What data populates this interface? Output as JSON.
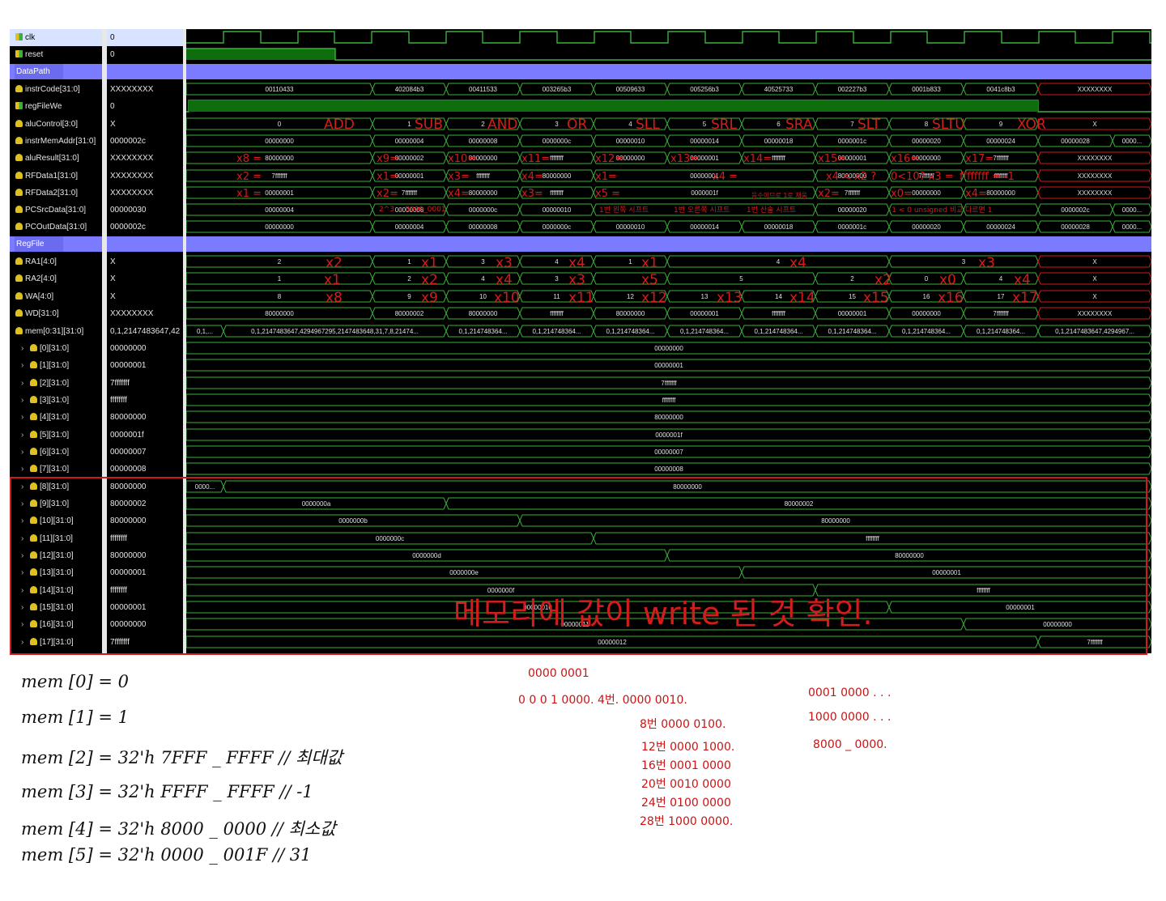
{
  "colors": {
    "accent": "#7b7bff",
    "wave": "#3ab03a",
    "background": "#000000",
    "ink": "#d41c1c",
    "undefined": "#d21919"
  },
  "signals": [
    {
      "icon": "bit-icon",
      "name": "clk",
      "value": "0",
      "selected": true
    },
    {
      "icon": "bit-icon",
      "name": "reset",
      "value": "0"
    },
    {
      "group": true,
      "name": "DataPath"
    },
    {
      "icon": "bus-icon",
      "name": "instrCode[31:0]",
      "value": "XXXXXXXX"
    },
    {
      "icon": "bit-icon",
      "name": "regFileWe",
      "value": "0"
    },
    {
      "icon": "bus-icon",
      "name": "aluControl[3:0]",
      "value": "X"
    },
    {
      "icon": "bus-icon",
      "name": "instrMemAddr[31:0]",
      "value": "0000002c"
    },
    {
      "icon": "bus-icon",
      "name": "aluResult[31:0]",
      "value": "XXXXXXXX"
    },
    {
      "icon": "bus-icon",
      "name": "RFData1[31:0]",
      "value": "XXXXXXXX"
    },
    {
      "icon": "bus-icon",
      "name": "RFData2[31:0]",
      "value": "XXXXXXXX"
    },
    {
      "icon": "bus-icon",
      "name": "PCSrcData[31:0]",
      "value": "00000030"
    },
    {
      "icon": "bus-icon",
      "name": "PCOutData[31:0]",
      "value": "0000002c"
    },
    {
      "group": true,
      "name": "RegFile"
    },
    {
      "icon": "bus-icon",
      "name": "RA1[4:0]",
      "value": "X"
    },
    {
      "icon": "bus-icon",
      "name": "RA2[4:0]",
      "value": "X"
    },
    {
      "icon": "bus-icon",
      "name": "WA[4:0]",
      "value": "X"
    },
    {
      "icon": "bus-icon",
      "name": "WD[31:0]",
      "value": "XXXXXXXX"
    },
    {
      "icon": "bus-icon",
      "name": "mem[0:31][31:0]",
      "value": "0,1,2147483647,42"
    },
    {
      "icon": "bus-icon",
      "name": "[0][31:0]",
      "value": "00000000",
      "child": true
    },
    {
      "icon": "bus-icon",
      "name": "[1][31:0]",
      "value": "00000001",
      "child": true
    },
    {
      "icon": "bus-icon",
      "name": "[2][31:0]",
      "value": "7fffffff",
      "child": true
    },
    {
      "icon": "bus-icon",
      "name": "[3][31:0]",
      "value": "ffffffff",
      "child": true
    },
    {
      "icon": "bus-icon",
      "name": "[4][31:0]",
      "value": "80000000",
      "child": true
    },
    {
      "icon": "bus-icon",
      "name": "[5][31:0]",
      "value": "0000001f",
      "child": true
    },
    {
      "icon": "bus-icon",
      "name": "[6][31:0]",
      "value": "00000007",
      "child": true
    },
    {
      "icon": "bus-icon",
      "name": "[7][31:0]",
      "value": "00000008",
      "child": true
    },
    {
      "icon": "bus-icon",
      "name": "[8][31:0]",
      "value": "80000000",
      "child": true
    },
    {
      "icon": "bus-icon",
      "name": "[9][31:0]",
      "value": "80000002",
      "child": true
    },
    {
      "icon": "bus-icon",
      "name": "[10][31:0]",
      "value": "80000000",
      "child": true
    },
    {
      "icon": "bus-icon",
      "name": "[11][31:0]",
      "value": "ffffffff",
      "child": true
    },
    {
      "icon": "bus-icon",
      "name": "[12][31:0]",
      "value": "80000000",
      "child": true
    },
    {
      "icon": "bus-icon",
      "name": "[13][31:0]",
      "value": "00000001",
      "child": true
    },
    {
      "icon": "bus-icon",
      "name": "[14][31:0]",
      "value": "ffffffff",
      "child": true
    },
    {
      "icon": "bus-icon",
      "name": "[15][31:0]",
      "value": "00000001",
      "child": true
    },
    {
      "icon": "bus-icon",
      "name": "[16][31:0]",
      "value": "00000000",
      "child": true
    },
    {
      "icon": "bus-icon",
      "name": "[17][31:0]",
      "value": "7fffffff",
      "child": true
    }
  ],
  "waves": {
    "instrCode": [
      "00110433",
      "402084b3",
      "00411533",
      "003265b3",
      "00509633",
      "005256b3",
      "40525733",
      "002227b3",
      "0001b833",
      "0041c8b3",
      "XXXXXXXX"
    ],
    "aluControl": [
      "0",
      "1",
      "2",
      "3",
      "4",
      "5",
      "6",
      "7",
      "8",
      "9",
      "X"
    ],
    "instrMemAddr": [
      "00000000",
      "00000004",
      "00000008",
      "0000000c",
      "00000010",
      "00000014",
      "00000018",
      "0000001c",
      "00000020",
      "00000024",
      "00000028",
      "0000..."
    ],
    "aluResult": [
      "80000000",
      "80000002",
      "80000000",
      "ffffffff",
      "80000000",
      "00000001",
      "ffffffff",
      "00000001",
      "00000000",
      "7fffffff",
      "XXXXXXXX"
    ],
    "RFData1": [
      "7fffffff",
      "00000001",
      "ffffffff",
      "80000000",
      "00000001",
      "80000000",
      "7fffffff",
      "XXXXXXXX"
    ],
    "RFData2": [
      "00000001",
      "7fffffff",
      "80000000",
      "ffffffff",
      "0000001f",
      "7fffffff",
      "00000000",
      "80000000",
      "XXXXXXXX"
    ],
    "PCSrcData": [
      "00000004",
      "00000008",
      "0000000c",
      "00000010",
      "00000020",
      "0000002c",
      "0000..."
    ],
    "PCOutData": [
      "00000000",
      "00000004",
      "00000008",
      "0000000c",
      "00000010",
      "00000014",
      "00000018",
      "0000001c",
      "00000020",
      "00000024",
      "00000028",
      "0000..."
    ],
    "RA1": [
      "2",
      "1",
      "3",
      "4",
      "1",
      "4",
      "3",
      "X"
    ],
    "RA2": [
      "1",
      "2",
      "4",
      "3",
      "5",
      "2",
      "0",
      "4",
      "X"
    ],
    "WA": [
      "8",
      "9",
      "10",
      "11",
      "12",
      "13",
      "14",
      "15",
      "16",
      "17",
      "X"
    ],
    "WD": [
      "80000000",
      "80000002",
      "80000000",
      "ffffffff",
      "80000000",
      "00000001",
      "ffffffff",
      "00000001",
      "00000000",
      "7fffffff",
      "XXXXXXXX"
    ],
    "mem": [
      "0,1,...",
      "0,1,2147483647,4294967295,2147483648,31,7,8,21474...",
      "0,1,214748364...",
      "0,1,2147483647,4294967..."
    ],
    "mem_consts": [
      "00000000",
      "00000001",
      "7fffffff",
      "ffffffff",
      "80000000",
      "0000001f",
      "00000007",
      "00000008"
    ],
    "mem8": [
      "0000...",
      "80000000"
    ],
    "mem9": [
      "0000000a",
      "80000002"
    ],
    "mem10": [
      "0000000b",
      "80000000"
    ],
    "mem11": [
      "0000000c",
      "ffffffff"
    ],
    "mem12": [
      "0000000d",
      "80000000"
    ],
    "mem13": [
      "0000000e",
      "00000001"
    ],
    "mem14": [
      "0000000f",
      "ffffffff"
    ],
    "mem15": [
      "00000010",
      "00000001"
    ],
    "mem16": [
      "00000011",
      "00000000"
    ],
    "mem17": [
      "00000012",
      "7fffffff"
    ]
  },
  "annotations": {
    "ops": [
      "ADD",
      "SUB",
      "AND",
      "OR",
      "SLL",
      "SRL",
      "SRA",
      "SLT",
      "SLTU",
      "XOR"
    ],
    "alu_regs": [
      "x8 =",
      "x9=",
      "x10=",
      "x11=",
      "x12=",
      "x13=",
      "x14=",
      "x15=",
      "x16=",
      "x17="
    ],
    "rf1_regs": [
      "x2 =",
      "x1=",
      "x3=",
      "x4=",
      "x1=",
      "x4 =",
      "x4 < x2 ?",
      "0<10? x3 =",
      "ffffffff = -1"
    ],
    "rf2_regs": [
      "x1 =",
      "x2=",
      "x4=",
      "x3=",
      "x5 =",
      "x2=",
      "x0=",
      "x4="
    ],
    "rf2_extra": [
      "2^3 = 8000_0001",
      "음수이므로 1로 채움"
    ],
    "pcsrc_notes": [
      "1번 왼쪽 시프트",
      "1번 오른쪽 시프트",
      "1번 산술 시프트",
      "-1 < 0 unsigned 비교",
      "다르면 1"
    ],
    "ra1_regs": [
      "x2",
      "x1",
      "x3",
      "x4",
      "x1",
      "x4",
      "x3"
    ],
    "ra2_regs": [
      "x1",
      "x2",
      "x4",
      "x3",
      "x5",
      "x2",
      "x0",
      "x4"
    ],
    "wa_regs": [
      "x8",
      "x9",
      "x10",
      "x11",
      "x12",
      "x13",
      "x14",
      "x15",
      "x16",
      "x17"
    ],
    "mem_caption": "메모리에 값이 write 된 것 확인.",
    "left_notes": [
      "mem [0] = 0",
      "mem [1] = 1",
      "mem [2] = 32'h 7FFF _ FFFF  // 최대값",
      "mem [3] = 32'h FFFF _ FFFF   // -1",
      "mem [4] = 32'h 8000 _ 0000  // 최소값",
      "mem [5] = 32'h 0000 _ 001F    // 31"
    ],
    "mid_notes": [
      "0000 0001",
      "0 0 0 1  0000.  4번.   0000 0010.",
      "8번    0000 0100.",
      "12번   0000 1000.",
      "16번   0001 0000",
      "20번   0010 0000",
      "24번   0100 0000",
      "28번   1000 0000."
    ],
    "right_notes": [
      "0001   0000 . . .",
      "1000   0000 . . .",
      "8000 _ 0000."
    ]
  }
}
